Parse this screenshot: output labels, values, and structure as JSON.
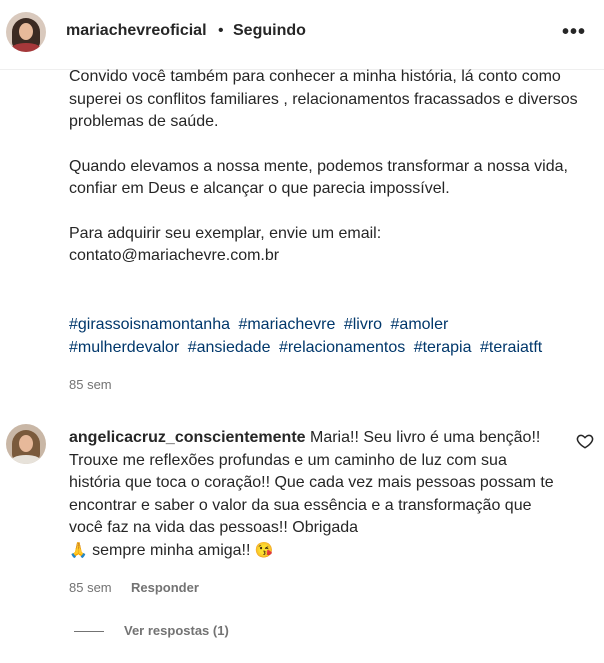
{
  "post": {
    "username": "mariachevreoficial",
    "separator": "•",
    "follow_status": "Seguindo",
    "more_label": "•••",
    "caption": {
      "p1": "Convido você também para conhecer a minha história, lá conto como superei os conflitos familiares , relacionamentos fracassados e diversos problemas de saúde.",
      "p2": "Quando elevamos a nossa mente, podemos transformar a nossa vida, confiar em Deus e alcançar o que parecia impossível.",
      "p3_line1": "Para adquirir seu exemplar, envie um email:",
      "p3_line2": "contato@mariachevre.com.br"
    },
    "hashtags": [
      "#girassoisnamontanha",
      "#mariachevre",
      "#livro",
      "#amoler",
      "#mulherdevalor",
      "#ansiedade",
      "#relacionamentos",
      "#terapia",
      "#teraiatft"
    ],
    "time": "85 sem"
  },
  "comment": {
    "username": "angelicacruz_conscientemente",
    "text": "Maria!! Seu livro é uma benção!! Trouxe me reflexões profundas e um caminho de luz com sua história que toca o coração!! Que cada vez mais pessoas possam te encontrar e saber o valor da sua essência e a transformação que você faz na vida das pessoas!! Obrigada",
    "emoji1": "🙏",
    "text_end": "sempre minha amiga!!",
    "emoji2": "😘",
    "time": "85 sem",
    "reply_label": "Responder",
    "view_replies_label": "Ver respostas (1)",
    "like_icon": "heart-outline-icon"
  }
}
